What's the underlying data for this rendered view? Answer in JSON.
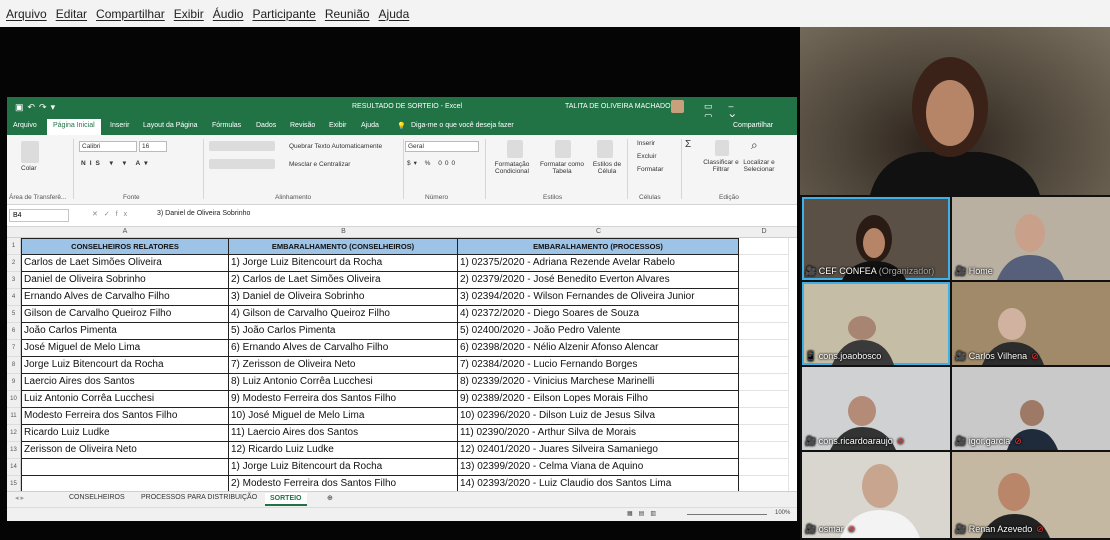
{
  "menu": [
    "Arquivo",
    "Editar",
    "Compartilhar",
    "Exibir",
    "Áudio",
    "Participante",
    "Reunião",
    "Ajuda"
  ],
  "excel": {
    "doc_title": "RESULTADO DE SORTEIO  -  Excel",
    "user": "TALITA DE OLIVEIRA MACHADO",
    "tabs": [
      "Arquivo",
      "Página Inicial",
      "Inserir",
      "Layout da Página",
      "Fórmulas",
      "Dados",
      "Revisão",
      "Exibir",
      "Ajuda"
    ],
    "tellme": "Diga-me o que você deseja fazer",
    "share": "Compartilhar",
    "ribbon": {
      "paste": "Colar",
      "clipboard": "Área de Transferê...",
      "font_name": "Calibri",
      "font_size": "16",
      "font_group": "Fonte",
      "wrap": "Quebrar Texto Automaticamente",
      "merge": "Mesclar e Centralizar",
      "align_group": "Alinhamento",
      "number_format": "Geral",
      "number_group": "Número",
      "cond": "Formatação Condicional",
      "table": "Formatar como Tabela",
      "cellstyles": "Estilos de Célula",
      "styles_group": "Estilos",
      "insert": "Inserir",
      "delete": "Excluir",
      "format": "Formatar",
      "cells_group": "Células",
      "sort": "Classificar e Filtrar",
      "find": "Localizar e Selecionar",
      "edit_group": "Edição"
    },
    "name_box": "B4",
    "formula": "3) Daniel de Oliveira Sobrinho",
    "columns": [
      "A",
      "B",
      "C",
      "D"
    ],
    "headers": [
      "CONSELHEIROS RELATORES",
      "EMBARALHAMENTO (CONSELHEIROS)",
      "EMBARALHAMENTO (PROCESSOS)"
    ],
    "rows": [
      [
        "Carlos de Laet Simões Oliveira",
        "1) Jorge Luiz Bitencourt da Rocha",
        "1) 02375/2020 - Adriana Rezende Avelar Rabelo"
      ],
      [
        "Daniel de Oliveira Sobrinho",
        "2) Carlos de Laet Simões Oliveira",
        "2) 02379/2020 - José Benedito Everton Alvares"
      ],
      [
        "Ernando Alves de Carvalho Filho",
        "3) Daniel de Oliveira Sobrinho",
        "3) 02394/2020 - Wilson Fernandes de Oliveira Junior"
      ],
      [
        "Gilson de Carvalho Queiroz Filho",
        "4) Gilson de Carvalho Queiroz Filho",
        "4) 02372/2020 - Diego Soares de Souza"
      ],
      [
        "João Carlos Pimenta",
        "5) João Carlos Pimenta",
        "5) 02400/2020 - João Pedro Valente"
      ],
      [
        "José Miguel de Melo Lima",
        "6) Ernando Alves de Carvalho Filho",
        "6) 02398/2020 - Nélio Alzenir Afonso Alencar"
      ],
      [
        "Jorge Luiz Bitencourt da Rocha",
        "7) Zerisson de Oliveira Neto",
        "7) 02384/2020 - Lucio Fernando Borges"
      ],
      [
        "Laercio Aires dos Santos",
        "8) Luiz Antonio Corrêa Lucchesi",
        "8) 02339/2020 - Vinicius Marchese Marinelli"
      ],
      [
        "Luiz Antonio Corrêa Lucchesi",
        "9) Modesto Ferreira dos Santos Filho",
        "9) 02389/2020 - Eilson Lopes Morais Filho"
      ],
      [
        "Modesto Ferreira dos Santos Filho",
        "10) José Miguel de Melo Lima",
        "10) 02396/2020 - Dilson Luiz de Jesus Silva"
      ],
      [
        "Ricardo Luiz Ludke",
        "11) Laercio Aires dos Santos",
        "11) 02390/2020 - Arthur Silva de Morais"
      ],
      [
        "Zerisson de Oliveira Neto",
        "12) Ricardo Luiz Ludke",
        "12) 02401/2020 - Juares Silveira Samaniego"
      ],
      [
        "",
        "1) Jorge Luiz Bitencourt da Rocha",
        "13) 02399/2020 - Celma Viana de Aquino"
      ],
      [
        "",
        "2) Modesto Ferreira dos Santos Filho",
        "14) 02393/2020 - Luiz Claudio dos Santos Lima"
      ]
    ],
    "sheets": [
      "CONSELHEIROS",
      "PROCESSOS PARA DISTRIBUIÇÃO",
      "SORTEIO"
    ],
    "zoom": "100%"
  },
  "participants": [
    {
      "name": "CEF CONFEA",
      "role": "(Organizador)"
    },
    {
      "name": "Home"
    },
    {
      "name": "cons.joaobosco"
    },
    {
      "name": "Carlos Vilhena"
    },
    {
      "name": "cons.ricardoaraujo"
    },
    {
      "name": "igor.garcia"
    },
    {
      "name": "osmar"
    },
    {
      "name": "Renan Azevedo"
    }
  ]
}
